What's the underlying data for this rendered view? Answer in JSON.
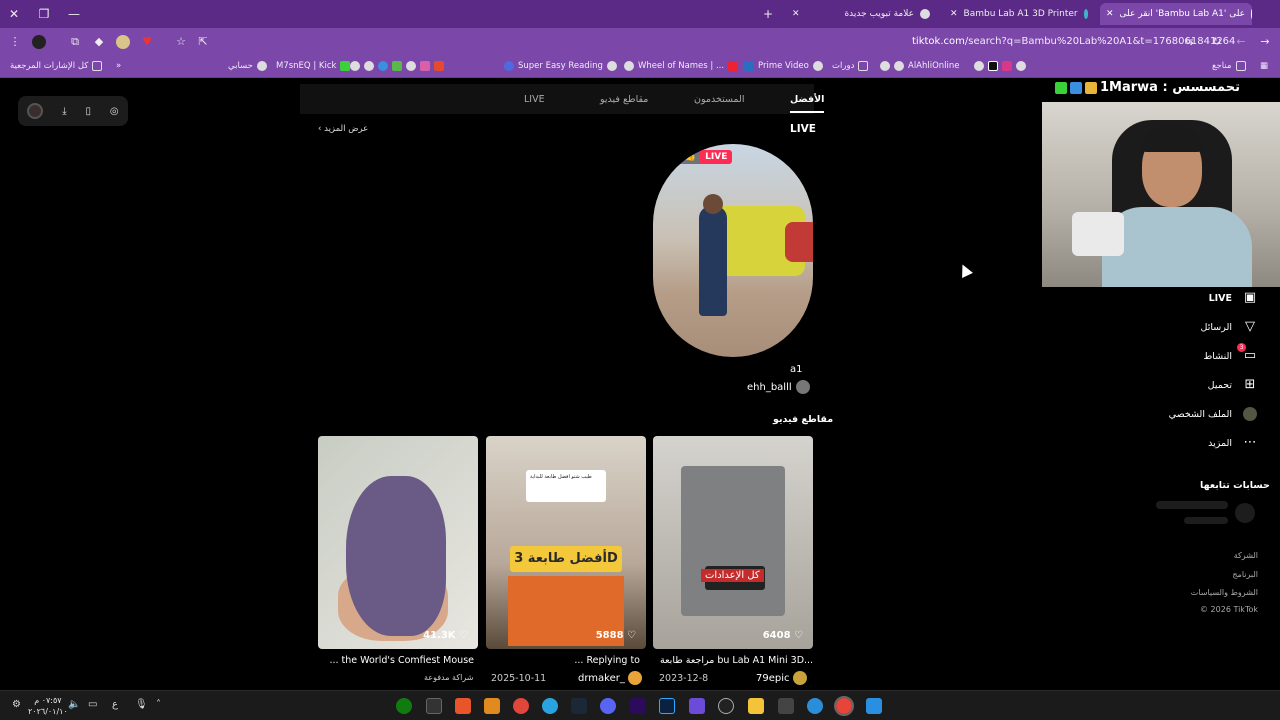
{
  "browser": {
    "tabs": [
      {
        "label": "انقر على 'Bambu Lab A1' على",
        "active": true
      },
      {
        "label": "Bambu Lab A1 3D Printer",
        "active": false
      },
      {
        "label": "علامة تبويب جديدة",
        "active": false
      }
    ],
    "url_domain": "tiktok.com",
    "url_path": "/search?q=Bambu%20Lab%20A1&t=1768061841264",
    "bookmarks": [
      "كل الإشارات المرجعية",
      "حسابي",
      "M7snEQ | Kick",
      "Super Easy Reading",
      "Wheel of Names | ...",
      "Prime Video",
      "دورات",
      "AlAhliOnline",
      "مناجع"
    ]
  },
  "search_tabs": {
    "top": "الأفضل",
    "users": "المستخدمون",
    "videos": "مقاطع فيديو",
    "live": "LIVE"
  },
  "live_section": {
    "heading": "LIVE",
    "see_more": "عرض المزيد",
    "card": {
      "viewers": "192",
      "badge": "LIVE",
      "title": "a1",
      "user": "ehh_balll"
    }
  },
  "videos_section": {
    "heading": "مقاطع فيديو",
    "videos": [
      {
        "likes": "41.3K",
        "title": "... the World's Comfiest Mouse",
        "meta": "شراكة مدفوعة",
        "user": ""
      },
      {
        "likes": "5888",
        "title": "... Replying to",
        "meta": "2025-10-11",
        "user": "drmaker_",
        "overlay": "أفضل طابعة 3D",
        "note": "طيب شتو افضل طابعة للبداية"
      },
      {
        "likes": "6408",
        "title": "مراجعة طابعة bu Lab A1 Mini 3D...",
        "meta": "2023-12-8",
        "user": "79epic",
        "overlay": "كل الإعدادات"
      }
    ]
  },
  "sidebar": {
    "items": [
      {
        "label": "LIVE",
        "icon": "live-tv-icon"
      },
      {
        "label": "الرسائل",
        "icon": "send-icon"
      },
      {
        "label": "النشاط",
        "icon": "activity-icon",
        "badge": "3"
      },
      {
        "label": "تحميل",
        "icon": "upload-icon"
      },
      {
        "label": "الملف الشخصي",
        "icon": "profile-icon"
      },
      {
        "label": "المزيد",
        "icon": "more-icon"
      }
    ],
    "following_heading": "حسابات تتابعها",
    "footer": [
      "الشركة",
      "البرنامج",
      "الشروط والسياسات",
      "© 2026 TikTok"
    ]
  },
  "overlay": {
    "stream_title": "1Marwa : تحمسسس"
  },
  "taskbar": {
    "time": "٠٧:٥٧ م",
    "date": "٢٠٢٦/٠١/١٠",
    "lang": "ع"
  },
  "colors": {
    "accent": "#fe2c55",
    "browser": "#7b47a8",
    "tabbar": "#5b2a86"
  }
}
